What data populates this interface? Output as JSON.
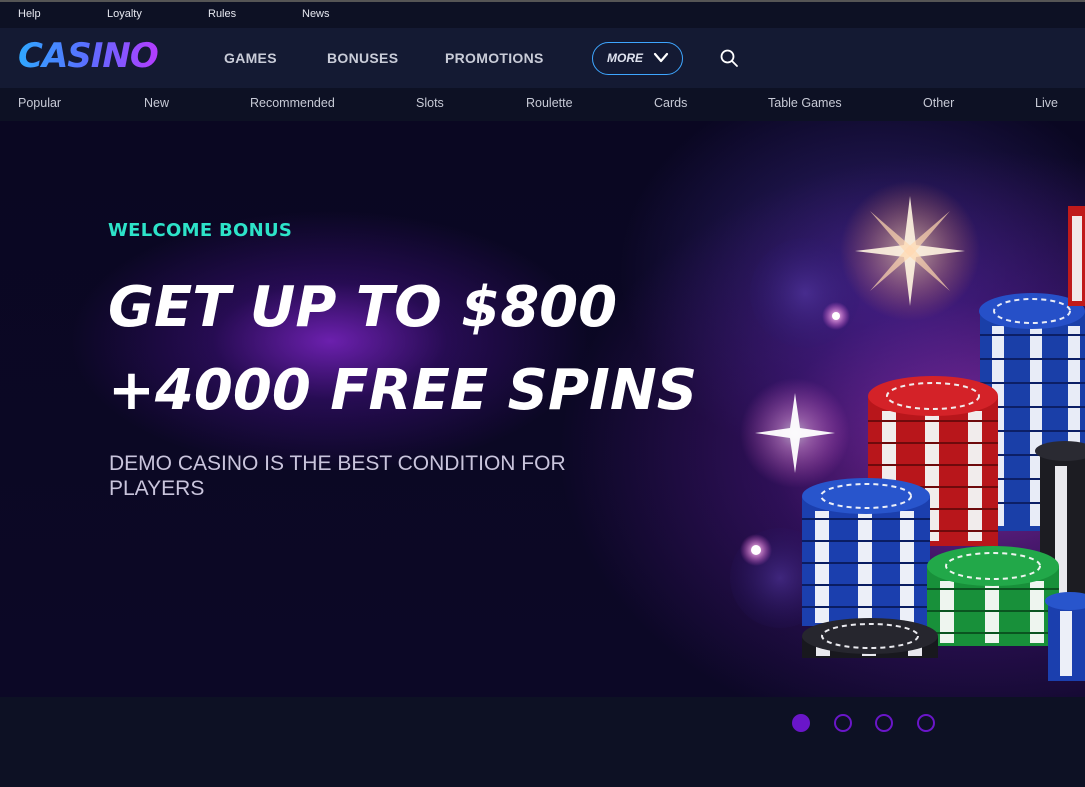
{
  "topbar": {
    "links": [
      "Help",
      "Loyalty",
      "Rules",
      "News"
    ]
  },
  "brand": {
    "logo_text": "CASINO"
  },
  "nav": {
    "items": [
      "GAMES",
      "BONUSES",
      "PROMOTIONS"
    ],
    "more_label": "MORE"
  },
  "categories": [
    "Popular",
    "New",
    "Recommended",
    "Slots",
    "Roulette",
    "Cards",
    "Table Games",
    "Other",
    "Live"
  ],
  "hero": {
    "eyebrow": "WELCOME BONUS",
    "headline_line1": "GET UP TO $800",
    "headline_line2": "+4000 FREE SPINS",
    "description": "DEMO CASINO IS THE BEST CONDITION FOR PLAYERS"
  },
  "slider": {
    "slide_count": 4,
    "active_index": 0
  },
  "colors": {
    "accent_teal": "#2de3c9",
    "accent_purple": "#6a16c9",
    "more_border": "#3ea6ff",
    "nav_bg": "#141a33",
    "page_bg": "#0d1124"
  },
  "icons": {
    "search": "search-icon",
    "more_chevron": "chevron-down-icon"
  }
}
